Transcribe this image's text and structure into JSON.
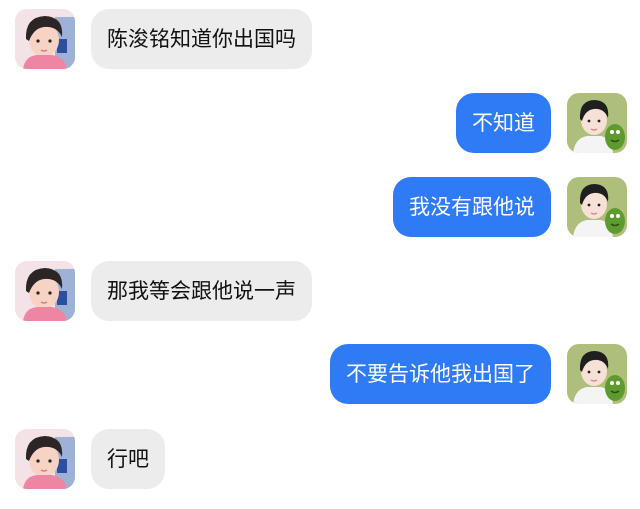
{
  "colors": {
    "incoming_bubble": "#ececec",
    "outgoing_bubble": "#2f7bf6",
    "incoming_text": "#111111",
    "outgoing_text": "#ffffff"
  },
  "messages": [
    {
      "side": "left",
      "avatar": "person-avatar-icon",
      "text": "陈浚铭知道你出国吗"
    },
    {
      "side": "right",
      "avatar": "person-with-plush-avatar-icon",
      "text": "不知道"
    },
    {
      "side": "right",
      "avatar": "person-with-plush-avatar-icon",
      "text": "我没有跟他说"
    },
    {
      "side": "left",
      "avatar": "person-avatar-icon",
      "text": "那我等会跟他说一声"
    },
    {
      "side": "right",
      "avatar": "person-with-plush-avatar-icon",
      "text": "不要告诉他我出国了"
    },
    {
      "side": "left",
      "avatar": "person-avatar-icon",
      "text": "行吧"
    }
  ]
}
